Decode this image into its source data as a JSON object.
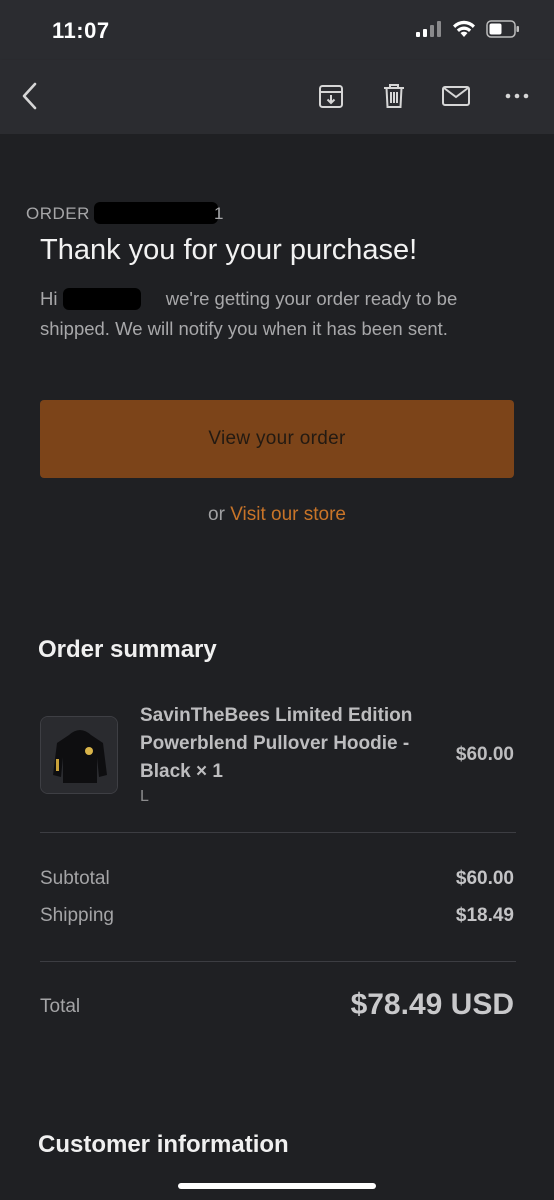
{
  "status_bar": {
    "time": "11:07"
  },
  "order": {
    "label": "ORDER",
    "label_tail": "1",
    "headline": "Thank you for your purchase!",
    "greeting_prefix": "Hi",
    "greeting_body": "we're getting your order ready to be shipped. We will notify you when it has been sent.",
    "view_order_label": "View your order",
    "or_text": "or",
    "visit_store_label": "Visit our store"
  },
  "summary": {
    "title": "Order summary",
    "item": {
      "name": "SavinTheBees Limited Edition Powerblend Pullover Hoodie - Black × 1",
      "variant": "L",
      "price": "$60.00"
    },
    "subtotal_label": "Subtotal",
    "subtotal_value": "$60.00",
    "shipping_label": "Shipping",
    "shipping_value": "$18.49",
    "total_label": "Total",
    "total_value": "$78.49 USD"
  },
  "customer": {
    "title": "Customer information"
  },
  "icons": {
    "back": "chevron-left-icon",
    "archive": "archive-icon",
    "trash": "trash-icon",
    "mail": "mail-icon",
    "more": "more-icon"
  },
  "colors": {
    "accent_button": "#7c4419",
    "link": "#c87428",
    "background": "#1f2023",
    "bar": "#2b2c30"
  }
}
